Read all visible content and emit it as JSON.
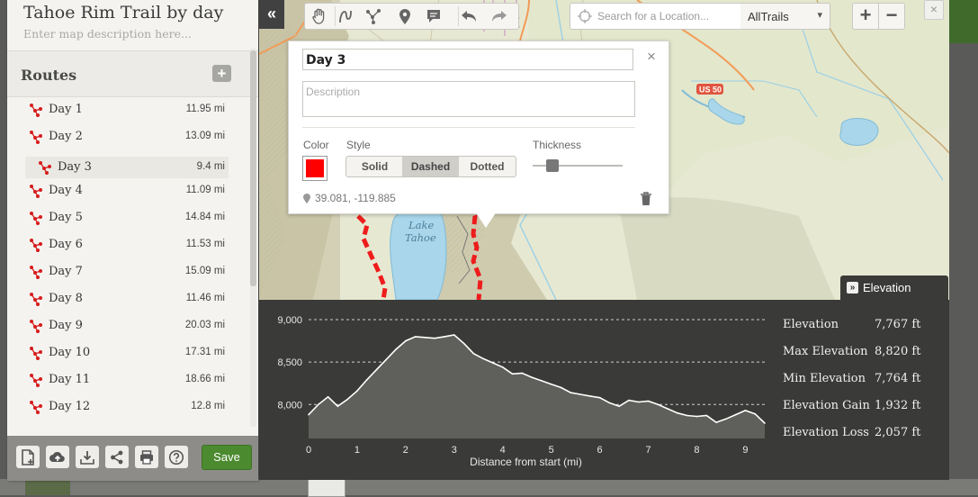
{
  "map": {
    "title": "Tahoe Rim Trail by day",
    "description_placeholder": "Enter map description here...",
    "lake_label_1": "Lake",
    "lake_label_2": "Tahoe",
    "highway_label": "US 50"
  },
  "routes": {
    "heading": "Routes",
    "add_label": "+",
    "items": [
      {
        "name": "Day 1",
        "distance": "11.95 mi"
      },
      {
        "name": "Day 2",
        "distance": "13.09 mi"
      },
      {
        "name": "Day 3",
        "distance": "9.4 mi"
      },
      {
        "name": "Day 4",
        "distance": "11.09 mi"
      },
      {
        "name": "Day 5",
        "distance": "14.84 mi"
      },
      {
        "name": "Day 6",
        "distance": "11.53 mi"
      },
      {
        "name": "Day 7",
        "distance": "15.09 mi"
      },
      {
        "name": "Day 8",
        "distance": "11.46 mi"
      },
      {
        "name": "Day 9",
        "distance": "20.03 mi"
      },
      {
        "name": "Day 10",
        "distance": "17.31 mi"
      },
      {
        "name": "Day 11",
        "distance": "18.66 mi"
      },
      {
        "name": "Day 12",
        "distance": "12.8 mi"
      }
    ],
    "selected_index": 2
  },
  "bottom_bar": {
    "icons": [
      "new-file-icon",
      "upload-icon",
      "download-icon",
      "share-icon",
      "print-icon",
      "help-icon"
    ],
    "save_label": "Save"
  },
  "toolbar": {
    "collapse_label": "«",
    "tools": [
      "hand-icon",
      "freehand-icon",
      "route-icon",
      "marker-icon",
      "note-icon",
      "undo-icon",
      "redo-icon"
    ],
    "search_placeholder": "Search for a Location...",
    "layer_value": "AllTrails",
    "zoom_in": "+",
    "zoom_out": "−",
    "close": "×"
  },
  "popup": {
    "name_value": "Day 3",
    "description_placeholder": "Description",
    "color_label": "Color",
    "color_value": "#ff0000",
    "style_label": "Style",
    "style_options": [
      "Solid",
      "Dashed",
      "Dotted"
    ],
    "style_selected": "Dashed",
    "thickness_label": "Thickness",
    "thickness_level": 0.22,
    "coordinates": "39.081, -119.885",
    "close": "×"
  },
  "elevation": {
    "tab_label": "Elevation",
    "tab_chevron": "»",
    "stats": [
      {
        "label": "Elevation",
        "value": "7,767 ft"
      },
      {
        "label": "Max Elevation",
        "value": "8,820 ft"
      },
      {
        "label": "Min Elevation",
        "value": "7,764 ft"
      },
      {
        "label": "Elevation Gain",
        "value": "1,932 ft"
      },
      {
        "label": "Elevation Loss",
        "value": "2,057 ft"
      }
    ]
  },
  "chart_data": {
    "type": "area",
    "title": "",
    "xlabel": "Distance from start (mi)",
    "ylabel": "",
    "xlim": [
      0,
      9.4
    ],
    "ylim": [
      7600,
      9000
    ],
    "x_ticks": [
      0,
      1,
      2,
      3,
      4,
      5,
      6,
      7,
      8,
      9
    ],
    "y_ticks": [
      8000,
      8500,
      9000
    ],
    "y_tick_labels": [
      "8,000",
      "8,500",
      "9,000"
    ],
    "grid": "horizontal dashed",
    "x": [
      0,
      0.2,
      0.4,
      0.6,
      0.8,
      1.0,
      1.2,
      1.4,
      1.6,
      1.8,
      2.0,
      2.2,
      2.4,
      2.6,
      2.8,
      3.0,
      3.2,
      3.4,
      3.6,
      3.8,
      4.0,
      4.2,
      4.4,
      4.6,
      4.8,
      5.0,
      5.2,
      5.4,
      5.6,
      5.8,
      6.0,
      6.2,
      6.4,
      6.6,
      6.8,
      7.0,
      7.2,
      7.4,
      7.6,
      7.8,
      8.0,
      8.2,
      8.4,
      8.6,
      8.8,
      9.0,
      9.2,
      9.4
    ],
    "y": [
      7880,
      8000,
      8090,
      7980,
      8060,
      8160,
      8290,
      8410,
      8530,
      8650,
      8750,
      8800,
      8790,
      8780,
      8800,
      8820,
      8720,
      8600,
      8540,
      8490,
      8440,
      8360,
      8370,
      8320,
      8280,
      8240,
      8200,
      8140,
      8120,
      8100,
      8080,
      8020,
      7980,
      8050,
      8030,
      8040,
      8000,
      7950,
      7900,
      7870,
      7860,
      7870,
      7790,
      7830,
      7880,
      7930,
      7890,
      7780
    ]
  }
}
